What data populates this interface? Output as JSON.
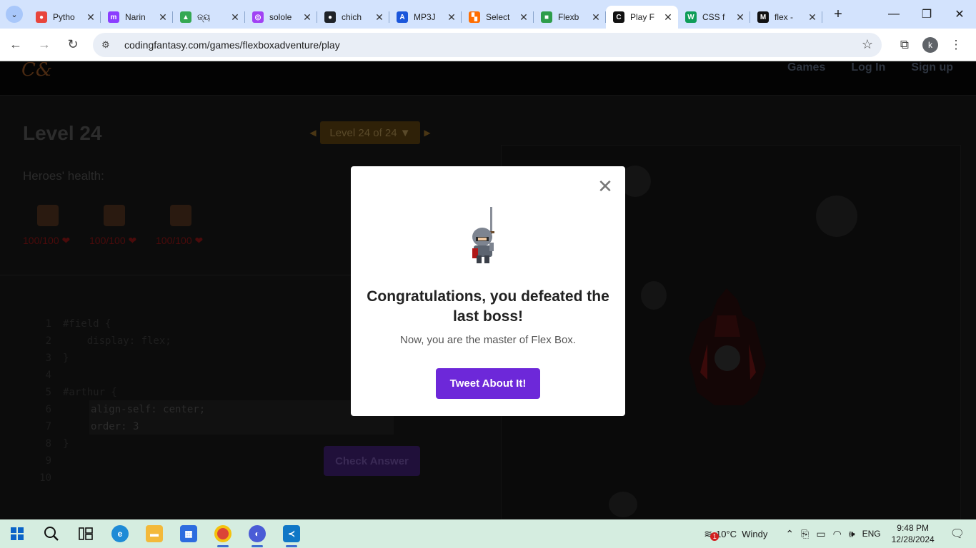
{
  "browser": {
    "tabs": [
      {
        "title": "Pytho",
        "favicon_color": "#e8453c",
        "favicon_glyph": "●"
      },
      {
        "title": "Narin",
        "favicon_color": "#8b3dff",
        "favicon_glyph": "m"
      },
      {
        "title": "ଜ୍ୟ",
        "favicon_color": "#34a853",
        "favicon_glyph": "▲"
      },
      {
        "title": "solole",
        "favicon_color": "#a142f4",
        "favicon_glyph": "◎"
      },
      {
        "title": "chich",
        "favicon_color": "#1f2328",
        "favicon_glyph": "●"
      },
      {
        "title": "MP3J",
        "favicon_color": "#1a56db",
        "favicon_glyph": "A"
      },
      {
        "title": "Select",
        "favicon_color": "#ff6d00",
        "favicon_glyph": "▚"
      },
      {
        "title": "Flexb",
        "favicon_color": "#2e9d4b",
        "favicon_glyph": "■"
      },
      {
        "title": "Play F",
        "favicon_color": "#111111",
        "favicon_glyph": "C"
      },
      {
        "title": "CSS f",
        "favicon_color": "#0f9d58",
        "favicon_glyph": "W"
      },
      {
        "title": "flex -",
        "favicon_color": "#111111",
        "favicon_glyph": "M"
      }
    ],
    "active_tab_index": 8,
    "url": "codingfantasy.com/games/flexboxadventure/play",
    "profile_initial": "k"
  },
  "site": {
    "logo": "C&",
    "nav": {
      "games": "Games",
      "login": "Log In",
      "signup": "Sign up"
    }
  },
  "game": {
    "level_title": "Level 24",
    "level_select": "Level 24 of 24 ▼",
    "health_label": "Heroes' health:",
    "heroes": [
      {
        "hp": "100/100 ❤"
      },
      {
        "hp": "100/100 ❤"
      },
      {
        "hp": "100/100 ❤"
      }
    ],
    "code_lines": [
      {
        "n": "1",
        "text": "#field {"
      },
      {
        "n": "2",
        "text": "    display: flex;"
      },
      {
        "n": "3",
        "text": "}"
      },
      {
        "n": "4",
        "text": ""
      },
      {
        "n": "5",
        "text": "#arthur {"
      },
      {
        "n": "6",
        "text": ""
      },
      {
        "n": "7",
        "text": ""
      },
      {
        "n": "8",
        "text": "}"
      },
      {
        "n": "9",
        "text": ""
      },
      {
        "n": "10",
        "text": ""
      }
    ],
    "input_lines": [
      "align-self: center;",
      "order: 3"
    ],
    "check_button": "Check Answer"
  },
  "modal": {
    "title": "Congratulations, you defeated the last boss!",
    "subtitle": "Now, you are the master of Flex Box.",
    "button": "Tweet About It!",
    "accent": "#6d28d9"
  },
  "taskbar": {
    "weather": "10°C  Windy",
    "weather_badge": "1",
    "language": "ENG",
    "time": "9:48 PM",
    "date": "12/28/2024"
  }
}
